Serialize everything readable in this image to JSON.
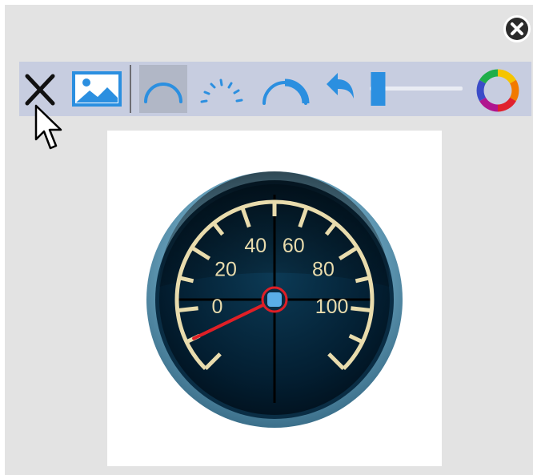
{
  "toolbar": {
    "items": [
      {
        "icon": "close-x-icon",
        "tooltip": "Remove"
      },
      {
        "icon": "image-icon",
        "tooltip": "Background image"
      },
      {
        "icon": "arc-icon",
        "tooltip": "Arc",
        "active": true
      },
      {
        "icon": "dashed-arc-icon",
        "tooltip": "Ticks"
      },
      {
        "icon": "thick-arc-icon",
        "tooltip": "Range"
      },
      {
        "icon": "undo-icon",
        "tooltip": "Undo"
      },
      {
        "icon": "slider-icon",
        "tooltip": "Size"
      },
      {
        "icon": "color-wheel-icon",
        "tooltip": "Color"
      }
    ],
    "slider_level": 0.1
  },
  "gauge": {
    "labels": [
      "0",
      "20",
      "40",
      "60",
      "80",
      "100"
    ],
    "min": -20,
    "max": 120,
    "needle_value": -10,
    "colors": {
      "face": "#021725",
      "rim": "#7fb7cf",
      "ticks": "#e9dcad",
      "needle": "#e01f26",
      "hub": "#5aaee8"
    }
  },
  "colors": {
    "panel": "#e3e3e3",
    "toolbar": "#c7cde0",
    "accent": "#2b8fe0"
  }
}
